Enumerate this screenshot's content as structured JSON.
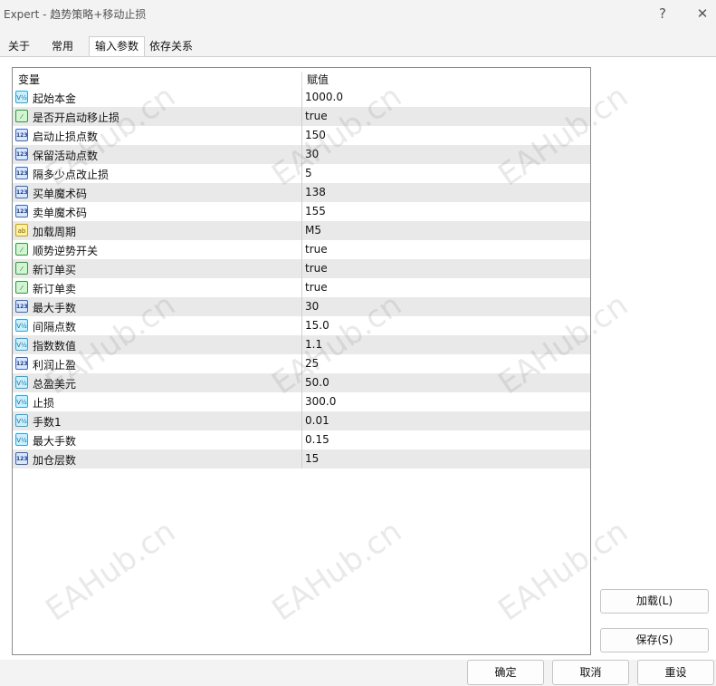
{
  "window": {
    "title": "Expert - 趋势策略+移动止损",
    "help_icon": "?",
    "close_icon": "✕"
  },
  "tabs": [
    "关于",
    "常用",
    "输入参数",
    "依存关系"
  ],
  "active_tab": "输入参数",
  "table": {
    "columns": [
      "变量",
      "赋值"
    ],
    "rows": [
      {
        "icon": "double",
        "name": "起始本金",
        "value": "1000.0"
      },
      {
        "icon": "bool",
        "name": "是否开启动移止损",
        "value": "true"
      },
      {
        "icon": "int",
        "name": "启动止损点数",
        "value": "150"
      },
      {
        "icon": "int",
        "name": "保留活动点数",
        "value": "30"
      },
      {
        "icon": "int",
        "name": "隔多少点改止损",
        "value": "5"
      },
      {
        "icon": "int",
        "name": "买单魔术码",
        "value": "138"
      },
      {
        "icon": "int",
        "name": "卖单魔术码",
        "value": "155"
      },
      {
        "icon": "str",
        "name": "加载周期",
        "value": "M5"
      },
      {
        "icon": "bool",
        "name": "顺势逆势开关",
        "value": "true"
      },
      {
        "icon": "bool",
        "name": "新订单买",
        "value": "true"
      },
      {
        "icon": "bool",
        "name": "新订单卖",
        "value": "true"
      },
      {
        "icon": "int",
        "name": "最大手数",
        "value": "30"
      },
      {
        "icon": "double",
        "name": "间隔点数",
        "value": "15.0"
      },
      {
        "icon": "double",
        "name": "指数数值",
        "value": "1.1"
      },
      {
        "icon": "int",
        "name": "利润止盈",
        "value": "25"
      },
      {
        "icon": "double",
        "name": "总盈美元",
        "value": "50.0"
      },
      {
        "icon": "double",
        "name": "止损",
        "value": "300.0"
      },
      {
        "icon": "double",
        "name": "手数1",
        "value": "0.01"
      },
      {
        "icon": "double",
        "name": "最大手数",
        "value": "0.15"
      },
      {
        "icon": "int",
        "name": "加仓层数",
        "value": "15"
      }
    ]
  },
  "icon_glyphs": {
    "double": "V½",
    "int": "123",
    "bool": "⁄",
    "str": "ab"
  },
  "side_buttons": {
    "load": "加载(L)",
    "save": "保存(S)"
  },
  "bottom_buttons": {
    "ok": "确定",
    "cancel": "取消",
    "reset": "重设"
  },
  "watermark": "EAHub.cn"
}
